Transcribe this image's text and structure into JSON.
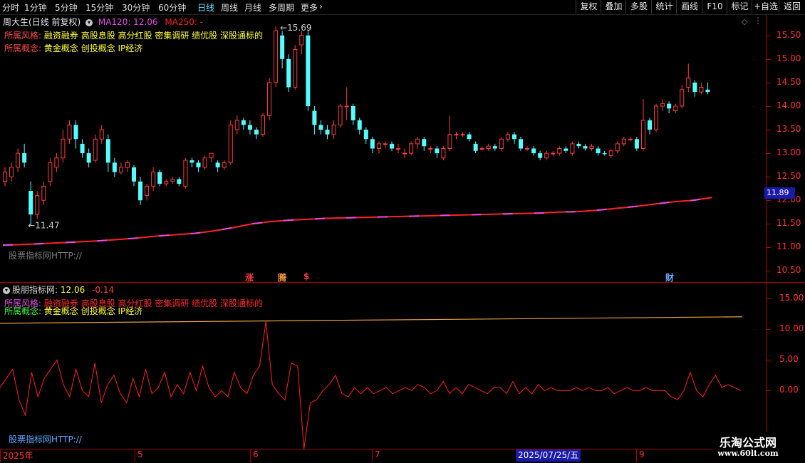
{
  "colors": {
    "bg": "#000000",
    "up": "#ff3c3c",
    "down": "#54ffff",
    "axis": "#ff3232",
    "ma120": "#e64ee6",
    "ma250": "#ff2222",
    "indicator": "#ff2020",
    "ind_ma": "#e8a040",
    "active_tab": "#66e6ff",
    "price_tag_bg": "#1a1aa8"
  },
  "toolbar": {
    "timeframes": [
      "分时",
      "1分钟",
      "5分钟",
      "15分钟",
      "30分钟",
      "60分钟",
      "日线",
      "周线",
      "月线",
      "多周期",
      "更多"
    ],
    "active_timeframe": "日线",
    "more_arrow": "›",
    "right_buttons": [
      "复权",
      "叠加",
      "多股",
      "统计",
      "画线",
      "F10",
      "标记",
      "+自选",
      "返回"
    ]
  },
  "main_header": {
    "stock_name": "周大生",
    "period": "(日线 前复权)",
    "ma120_label": "MA120: 12.06",
    "ma250_label": "MA250: -",
    "style_label": "所属风格:",
    "style_value": "融资融券 高股息股 高分红股 密集调研 绩优股 深股通标的",
    "concept_label": "所属概念:",
    "concept_value": "黄金概念 创投概念 IP经济",
    "watermark": "股票指标网HTTP://",
    "high_label": "15.69",
    "low_label": "11.47",
    "current_price": "11.89"
  },
  "markers": {
    "zhang": "涨",
    "teng": "腾",
    "dollar": "$",
    "cai": "财"
  },
  "indicator_header": {
    "name": "股朋指标网",
    "value": ": 12.06",
    "change": "-0.14",
    "watermark": "股票指标网HTTP://"
  },
  "date_axis": {
    "labels": [
      {
        "text": "2025年",
        "pos": 0.0
      },
      {
        "text": "5",
        "pos": 0.189
      },
      {
        "text": "6",
        "pos": 0.351
      },
      {
        "text": "7",
        "pos": 0.522
      },
      {
        "text": "9",
        "pos": 0.893
      }
    ],
    "selected_date": "2025/07/25/五",
    "selected_pos": 0.672
  },
  "logo": {
    "name": "乐淘公式网",
    "url": "www.60lt.com"
  },
  "chart_data": [
    {
      "type": "candlestick",
      "price_axis_ticks": [
        "15.50",
        "15.00",
        "14.50",
        "14.00",
        "13.50",
        "13.00",
        "12.50",
        "12.00",
        "11.50",
        "11.00",
        "10.50"
      ],
      "ylim": [
        10.25,
        15.95
      ],
      "candles": [
        [
          12.4,
          12.6,
          12.7,
          12.3
        ],
        [
          12.5,
          12.7,
          12.8,
          12.4
        ],
        [
          12.7,
          13.0,
          13.1,
          12.6
        ],
        [
          13.0,
          12.8,
          13.2,
          12.7
        ],
        [
          12.2,
          11.7,
          12.4,
          11.47
        ],
        [
          11.7,
          12.1,
          12.2,
          11.6
        ],
        [
          12.0,
          12.3,
          12.4,
          11.9
        ],
        [
          12.4,
          12.8,
          12.9,
          12.3
        ],
        [
          12.7,
          12.9,
          13.0,
          12.6
        ],
        [
          12.9,
          13.3,
          13.5,
          12.8
        ],
        [
          13.3,
          13.6,
          13.7,
          13.2
        ],
        [
          13.6,
          13.3,
          13.7,
          13.1
        ],
        [
          13.2,
          13.0,
          13.3,
          12.9
        ],
        [
          13.0,
          12.8,
          13.1,
          12.7
        ],
        [
          12.85,
          13.3,
          13.4,
          12.8
        ],
        [
          13.3,
          13.5,
          13.6,
          13.2
        ],
        [
          13.3,
          12.8,
          13.4,
          12.6
        ],
        [
          12.8,
          12.6,
          12.9,
          12.5
        ],
        [
          12.6,
          12.7,
          12.8,
          12.55
        ],
        [
          12.7,
          12.8,
          12.85,
          12.6
        ],
        [
          12.7,
          12.4,
          12.75,
          12.3
        ],
        [
          12.4,
          12.0,
          12.5,
          11.9
        ],
        [
          12.1,
          12.3,
          12.35,
          12.0
        ],
        [
          12.3,
          12.6,
          12.7,
          12.2
        ],
        [
          12.6,
          12.35,
          12.65,
          12.3
        ],
        [
          12.35,
          12.4,
          12.45,
          12.3
        ],
        [
          12.4,
          12.45,
          12.5,
          12.35
        ],
        [
          12.45,
          12.35,
          12.5,
          12.3
        ],
        [
          12.3,
          12.85,
          12.9,
          12.25
        ],
        [
          12.85,
          12.8,
          12.9,
          12.7
        ],
        [
          12.8,
          12.7,
          12.85,
          12.6
        ],
        [
          12.7,
          12.9,
          12.95,
          12.65
        ],
        [
          12.9,
          13.0,
          13.0,
          12.8
        ],
        [
          12.8,
          12.7,
          12.85,
          12.6
        ],
        [
          12.7,
          12.8,
          12.85,
          12.65
        ],
        [
          12.8,
          13.6,
          13.7,
          12.75
        ],
        [
          13.5,
          13.7,
          13.8,
          13.4
        ],
        [
          13.7,
          13.6,
          13.75,
          13.5
        ],
        [
          13.6,
          13.5,
          13.7,
          13.4
        ],
        [
          13.5,
          13.4,
          13.55,
          13.3
        ],
        [
          13.4,
          13.8,
          13.85,
          13.35
        ],
        [
          13.8,
          14.5,
          14.6,
          13.7
        ],
        [
          14.5,
          15.6,
          15.69,
          14.4
        ],
        [
          15.5,
          15.0,
          15.6,
          14.8
        ],
        [
          15.0,
          14.4,
          15.1,
          14.3
        ],
        [
          14.4,
          15.2,
          15.3,
          14.35
        ],
        [
          15.3,
          15.5,
          15.6,
          15.1
        ],
        [
          15.5,
          14.0,
          15.6,
          13.9
        ],
        [
          13.9,
          13.6,
          14.0,
          13.4
        ],
        [
          13.6,
          13.5,
          13.7,
          13.4
        ],
        [
          13.5,
          13.4,
          13.6,
          13.3
        ],
        [
          13.4,
          13.6,
          13.7,
          13.3
        ],
        [
          13.6,
          14.0,
          14.05,
          13.55
        ],
        [
          14.0,
          14.0,
          14.4,
          13.7
        ],
        [
          14.0,
          13.7,
          14.05,
          13.6
        ],
        [
          13.7,
          13.5,
          13.75,
          13.4
        ],
        [
          13.5,
          13.3,
          13.55,
          13.2
        ],
        [
          13.3,
          13.1,
          13.35,
          13.0
        ],
        [
          13.1,
          13.2,
          13.25,
          13.0
        ],
        [
          13.2,
          13.2,
          13.25,
          13.1
        ],
        [
          13.2,
          13.1,
          13.25,
          13.05
        ],
        [
          13.1,
          13.1,
          13.2,
          13.0
        ],
        [
          13.0,
          13.0,
          13.1,
          12.9
        ],
        [
          13.0,
          13.2,
          13.25,
          12.95
        ],
        [
          13.2,
          13.3,
          13.35,
          13.1
        ],
        [
          13.3,
          13.15,
          13.35,
          13.05
        ],
        [
          13.1,
          13.1,
          13.15,
          13.0
        ],
        [
          13.1,
          13.0,
          13.15,
          12.9
        ],
        [
          12.9,
          13.1,
          13.15,
          12.85
        ],
        [
          13.1,
          13.4,
          13.8,
          13.05
        ],
        [
          13.4,
          13.4,
          13.45,
          13.3
        ],
        [
          13.4,
          13.4,
          13.45,
          13.35
        ],
        [
          13.4,
          13.3,
          13.45,
          13.25
        ],
        [
          13.2,
          13.05,
          13.25,
          13.0
        ],
        [
          13.1,
          13.1,
          13.15,
          13.05
        ],
        [
          13.1,
          13.15,
          13.2,
          13.05
        ],
        [
          13.15,
          13.1,
          13.2,
          13.05
        ],
        [
          13.1,
          13.3,
          13.35,
          13.05
        ],
        [
          13.3,
          13.4,
          13.45,
          13.25
        ],
        [
          13.4,
          13.3,
          13.45,
          13.2
        ],
        [
          13.3,
          13.1,
          13.35,
          13.05
        ],
        [
          13.1,
          13.1,
          13.15,
          13.05
        ],
        [
          13.1,
          13.0,
          13.15,
          12.95
        ],
        [
          13.0,
          12.9,
          13.05,
          12.85
        ],
        [
          12.9,
          13.0,
          13.05,
          12.85
        ],
        [
          13.0,
          13.0,
          13.05,
          12.95
        ],
        [
          13.0,
          13.1,
          13.15,
          12.95
        ],
        [
          13.1,
          13.05,
          13.15,
          13.0
        ],
        [
          13.0,
          13.2,
          13.25,
          12.95
        ],
        [
          13.2,
          13.15,
          13.25,
          13.1
        ],
        [
          13.15,
          13.1,
          13.2,
          13.05
        ],
        [
          13.1,
          13.15,
          13.2,
          13.05
        ],
        [
          13.1,
          13.0,
          13.15,
          12.95
        ],
        [
          13.0,
          12.98,
          13.05,
          12.95
        ],
        [
          12.95,
          13.05,
          13.1,
          12.9
        ],
        [
          13.05,
          13.2,
          13.25,
          13.0
        ],
        [
          13.2,
          13.3,
          13.35,
          13.15
        ],
        [
          13.3,
          13.3,
          13.35,
          13.25
        ],
        [
          13.3,
          13.1,
          13.35,
          13.05
        ],
        [
          13.1,
          13.7,
          14.15,
          13.05
        ],
        [
          13.7,
          13.5,
          13.75,
          13.4
        ],
        [
          13.5,
          14.0,
          14.05,
          13.45
        ],
        [
          14.0,
          14.05,
          14.15,
          13.9
        ],
        [
          14.05,
          13.95,
          14.1,
          13.85
        ],
        [
          13.9,
          14.0,
          14.05,
          13.85
        ],
        [
          14.0,
          14.35,
          14.45,
          13.95
        ],
        [
          14.4,
          14.6,
          14.9,
          14.3
        ],
        [
          14.5,
          14.3,
          14.55,
          14.2
        ],
        [
          14.3,
          14.4,
          14.5,
          14.25
        ],
        [
          14.35,
          14.3,
          14.5,
          14.25
        ]
      ],
      "ma120": [
        11.05,
        11.06,
        11.08,
        11.1,
        11.12,
        11.14,
        11.17,
        11.2,
        11.24,
        11.27,
        11.3,
        11.35,
        11.42,
        11.5,
        11.55,
        11.58,
        11.6,
        11.62,
        11.63,
        11.64,
        11.65,
        11.66,
        11.67,
        11.68,
        11.69,
        11.7,
        11.71,
        11.72,
        11.73,
        11.75,
        11.76,
        11.79,
        11.83,
        11.87,
        11.92,
        11.97,
        12.0,
        12.06
      ]
    },
    {
      "type": "line",
      "axis_ticks": [
        "15.00",
        "10.00",
        "5.00",
        "0.00"
      ],
      "ylim": [
        -9.5,
        17.5
      ],
      "ma_line": [
        11.0,
        12.06
      ],
      "values": [
        0.5,
        2,
        3.5,
        -1.5,
        -4,
        3,
        -1,
        2,
        3.5,
        5,
        1,
        -1,
        3.5,
        0,
        -1,
        4.5,
        -2,
        1,
        2.5,
        -0.5,
        -2,
        2,
        -1,
        3.5,
        -0.5,
        0.5,
        3,
        -1,
        1,
        -0.5,
        3,
        0,
        4,
        0.5,
        -1,
        0,
        -1,
        3,
        0.5,
        -0.5,
        2.5,
        4,
        11.3,
        1,
        -0.5,
        -1.5,
        4.5,
        4,
        -9.5,
        -2,
        -1.5,
        0,
        1,
        2.5,
        -0.5,
        -1,
        0.5,
        -0.5,
        0.5,
        -0.5,
        0,
        0.5,
        -0.5,
        0,
        0.5,
        0,
        1,
        0.5,
        -0.5,
        0,
        1.5,
        -0.5,
        0.5,
        -0.5,
        1,
        0.5,
        0,
        -0.5,
        0.5,
        0.5,
        -0.5,
        1.5,
        -0.5,
        0.5,
        -0.5,
        1,
        0,
        0.5,
        0,
        0,
        0,
        0.5,
        0,
        0.5,
        0,
        0,
        0.5,
        -0.5,
        0,
        0.5,
        0,
        0,
        0.5,
        0,
        0,
        0,
        -1,
        -1.5,
        0,
        3,
        0,
        -1,
        1,
        2.5,
        0.5,
        1,
        0.5,
        0
      ]
    }
  ]
}
